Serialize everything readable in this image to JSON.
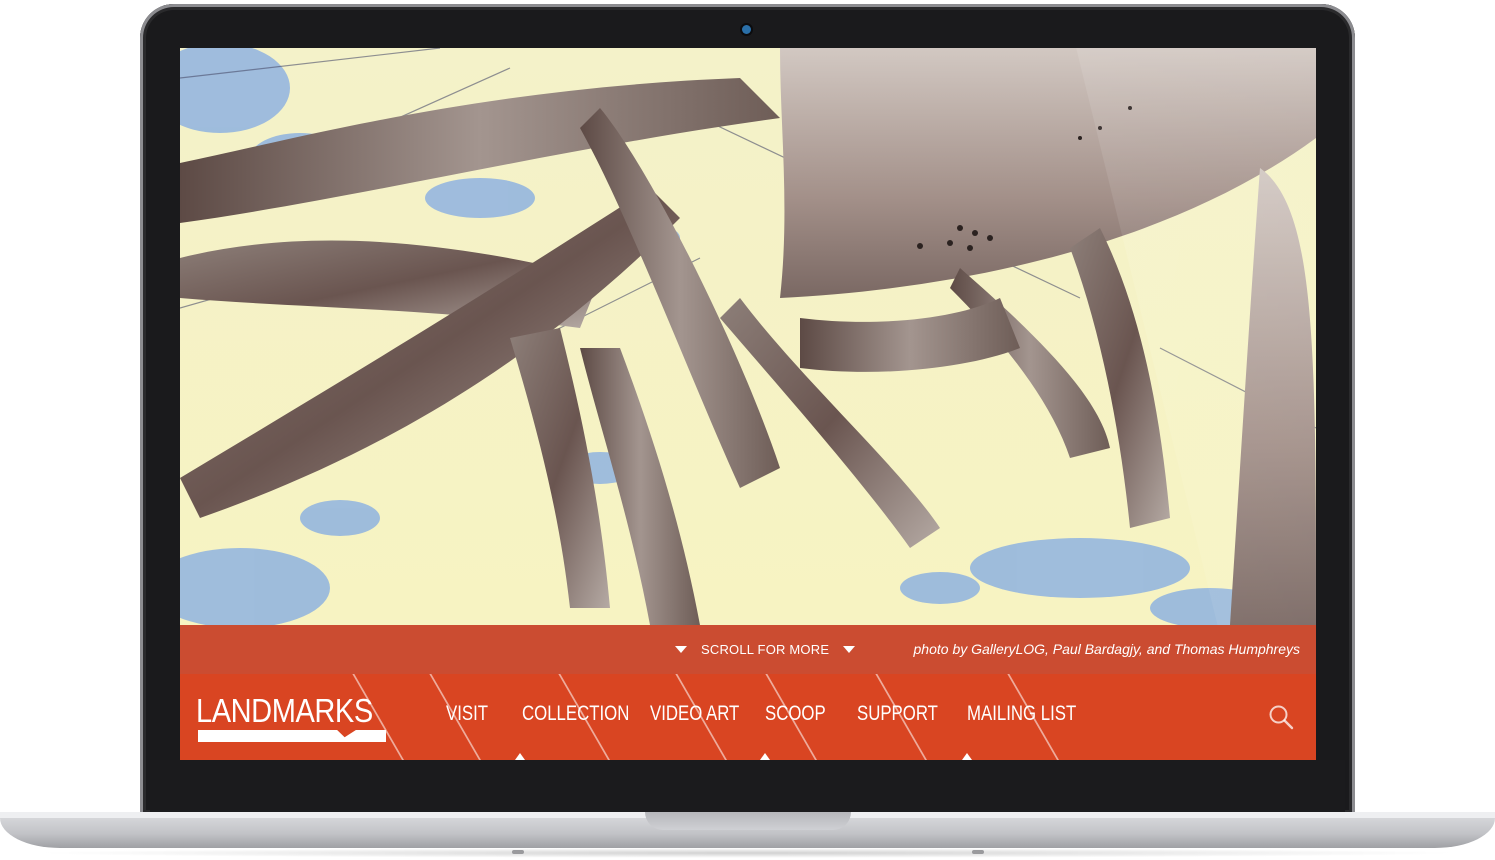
{
  "site": {
    "logo_text": "LANDMARKS",
    "caption": {
      "scroll_label": "SCROLL FOR MORE",
      "photo_credit": "photo by GalleryLOG, Paul Bardagjy, and Thomas Humphreys"
    },
    "nav": {
      "items": [
        {
          "label": "VISIT"
        },
        {
          "label": "COLLECTION"
        },
        {
          "label": "VIDEO ART"
        },
        {
          "label": "SCOOP"
        },
        {
          "label": "SUPPORT"
        },
        {
          "label": "MAILING LIST"
        }
      ],
      "search_icon": "search-icon"
    },
    "colors": {
      "nav_bg": "#d94522",
      "caption_bg": "#c83e24",
      "text": "#ffffff"
    }
  }
}
